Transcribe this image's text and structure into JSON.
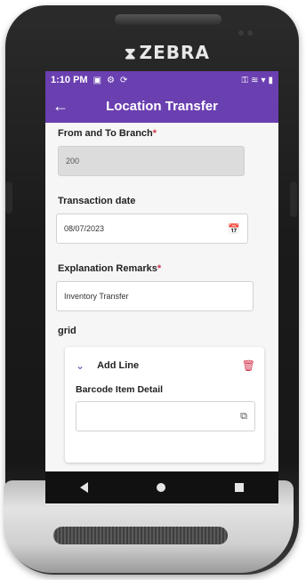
{
  "device": {
    "brand": "ZEBRA",
    "brand_icon": "zebra-logo-icon"
  },
  "statusbar": {
    "time": "1:10 PM",
    "icons": {
      "left": [
        "image-icon",
        "gear-icon",
        "sync-icon"
      ],
      "right": [
        "key-icon",
        "vibrate-icon",
        "wifi-icon",
        "battery-icon"
      ]
    }
  },
  "appbar": {
    "back_icon": "arrow-left-icon",
    "title": "Location Transfer"
  },
  "form": {
    "branch": {
      "label": "From and To Branch",
      "required_mark": "*",
      "value": "200"
    },
    "date": {
      "label": "Transaction date",
      "value": "08/07/2023",
      "icon": "calendar-icon"
    },
    "remarks": {
      "label": "Explanation Remarks",
      "required_mark": "*",
      "value": "Inventory Transfer"
    },
    "grid_label": "grid",
    "line_card": {
      "chevron_icon": "chevron-down-icon",
      "title": "Add Line",
      "delete_icon": "trash-icon",
      "barcode_label": "Barcode Item Detail",
      "barcode_value": "",
      "scan_icon": "barcode-scan-icon"
    }
  },
  "navbar": {
    "back": "back-nav-icon",
    "home": "home-nav-icon",
    "recent": "recent-apps-icon"
  },
  "colors": {
    "primary": "#6a3fb0",
    "required": "#d0334a",
    "background": "#f6f6f6"
  }
}
